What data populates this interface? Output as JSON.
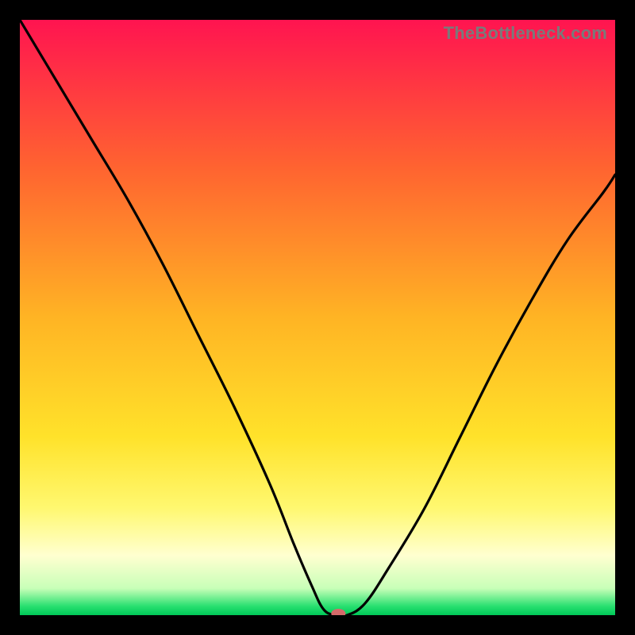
{
  "watermark": "TheBottleneck.com",
  "chart_data": {
    "type": "line",
    "title": "",
    "xlabel": "",
    "ylabel": "",
    "xlim": [
      0,
      100
    ],
    "ylim": [
      0,
      100
    ],
    "background_gradient": [
      {
        "pos": 0.0,
        "color": "#ff1450"
      },
      {
        "pos": 0.25,
        "color": "#ff6430"
      },
      {
        "pos": 0.5,
        "color": "#ffb424"
      },
      {
        "pos": 0.7,
        "color": "#ffe22a"
      },
      {
        "pos": 0.82,
        "color": "#fff870"
      },
      {
        "pos": 0.9,
        "color": "#ffffd0"
      },
      {
        "pos": 0.955,
        "color": "#c8ffb8"
      },
      {
        "pos": 0.985,
        "color": "#28e070"
      },
      {
        "pos": 1.0,
        "color": "#00c858"
      }
    ],
    "series": [
      {
        "name": "bottleneck-curve",
        "x": [
          0,
          6,
          12,
          18,
          24,
          30,
          36,
          42,
          46,
          49,
          51,
          53,
          55,
          58,
          62,
          68,
          74,
          80,
          86,
          92,
          98,
          100
        ],
        "y": [
          100,
          90,
          80,
          70,
          59,
          47,
          35,
          22,
          12,
          5,
          1,
          0,
          0,
          2,
          8,
          18,
          30,
          42,
          53,
          63,
          71,
          74
        ]
      }
    ],
    "marker": {
      "x": 53.5,
      "y": 0,
      "color": "#d46a6a",
      "rx": 9,
      "ry": 6
    }
  }
}
